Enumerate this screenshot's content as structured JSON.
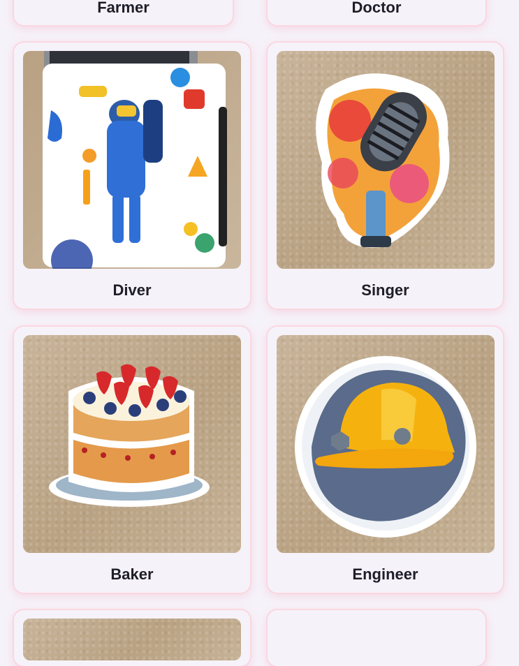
{
  "cards": [
    {
      "label": "Farmer"
    },
    {
      "label": "Doctor"
    },
    {
      "label": "Diver"
    },
    {
      "label": "Singer"
    },
    {
      "label": "Baker"
    },
    {
      "label": "Engineer"
    },
    {
      "label": ""
    },
    {
      "label": ""
    }
  ]
}
